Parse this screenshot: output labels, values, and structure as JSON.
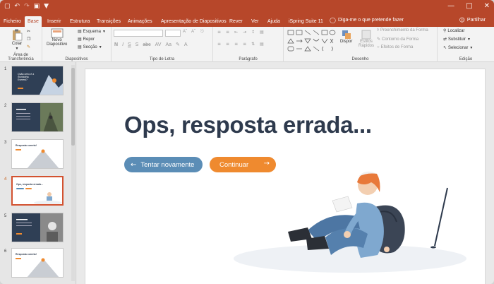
{
  "titlebar": {
    "qat_icons": [
      "save-icon",
      "undo-icon",
      "redo-icon",
      "slideshow-icon",
      "customize-icon"
    ],
    "window_controls": [
      "minimize-icon",
      "maximize-icon",
      "close-icon"
    ]
  },
  "tabs": [
    {
      "label": "Ficheiro"
    },
    {
      "label": "Base",
      "active": true
    },
    {
      "label": "Inserir"
    },
    {
      "label": "Estrutura"
    },
    {
      "label": "Transições"
    },
    {
      "label": "Animações"
    },
    {
      "label": "Apresentação de Diapositivos"
    },
    {
      "label": "Rever"
    },
    {
      "label": "Ver"
    },
    {
      "label": "Ajuda"
    },
    {
      "label": "iSpring Suite 11"
    }
  ],
  "tellme": "Diga-me o que pretende fazer",
  "share": "Partilhar",
  "ribbon": {
    "clipboard": {
      "paste": "Colar",
      "label": "Área de Transferência"
    },
    "slides": {
      "new": "Novo",
      "new2": "Diapositivo",
      "layout": "Esquema",
      "reset": "Repor",
      "section": "Secção",
      "label": "Diapositivos"
    },
    "font": {
      "label": "Tipo de Letra"
    },
    "paragraph": {
      "label": "Parágrafo"
    },
    "drawing": {
      "arrange": "Dispor",
      "quick1": "Estilos",
      "quick2": "Rápidos",
      "fill": "Preenchimento da Forma",
      "outline": "Contorno da Forma",
      "effects": "Efeitos de Forma",
      "label": "Desenho"
    },
    "editing": {
      "find": "Localizar",
      "replace": "Substituir",
      "select": "Selecionar",
      "label": "Edição"
    }
  },
  "thumbnails": [
    {
      "num": "1",
      "title": "Quão certo é a montanha Everest?"
    },
    {
      "num": "2"
    },
    {
      "num": "3",
      "title": "Resposta correta!"
    },
    {
      "num": "4",
      "title": "Ops, resposta errada...",
      "selected": true
    },
    {
      "num": "5"
    },
    {
      "num": "6",
      "title": "Resposta correta!"
    }
  ],
  "slide": {
    "title": "Ops, resposta errada...",
    "retry": "Tentar novamente",
    "continue": "Continuar",
    "colors": {
      "title": "#2e3a4d",
      "retry": "#5b8db6",
      "continue": "#ef8a2f"
    }
  }
}
